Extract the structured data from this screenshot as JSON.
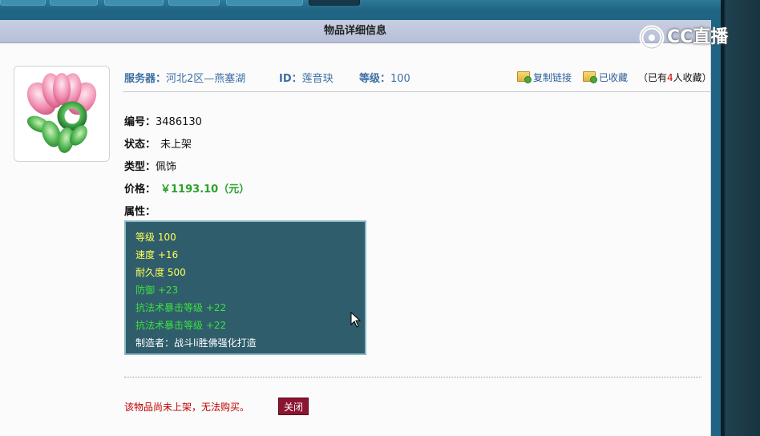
{
  "panel": {
    "title": "物品详细信息"
  },
  "header": {
    "server_label": "服务器：",
    "server_value": "河北2区—燕塞湖",
    "id_label": "ID：",
    "id_value": "莲音玦",
    "level_label": "等级：",
    "level_value": "100",
    "copy_link": "复制链接",
    "favorited": "已收藏",
    "fav_prefix": "（已有",
    "fav_count": "4",
    "fav_suffix": "人收藏）"
  },
  "info": {
    "number_label": "编号：",
    "number_value": "3486130",
    "status_label": "状态：",
    "status_value": "未上架",
    "type_label": "类型：",
    "type_value": "佩饰",
    "price_label": "价格：",
    "price_value": "￥1193.10（元）",
    "attr_label": "属性："
  },
  "attributes": [
    "等级 100",
    "速度 +16",
    "耐久度 500",
    "防御 +23",
    "抗法术暴击等级 +22",
    "抗法术暴击等级 +22",
    "制造者：战斗li胜佛强化打造"
  ],
  "footer": {
    "notice": "该物品尚未上架，无法购买。",
    "close_button": "关闭"
  },
  "watermark": {
    "text": "CC直播"
  },
  "colors": {
    "price": "#2aa12a",
    "attr_base": "#ffff55",
    "attr_bonus": "#3ee03e",
    "notice": "#c00000",
    "close_button_bg": "#8b1530",
    "attr_box_bg": "#2f5d6c"
  }
}
